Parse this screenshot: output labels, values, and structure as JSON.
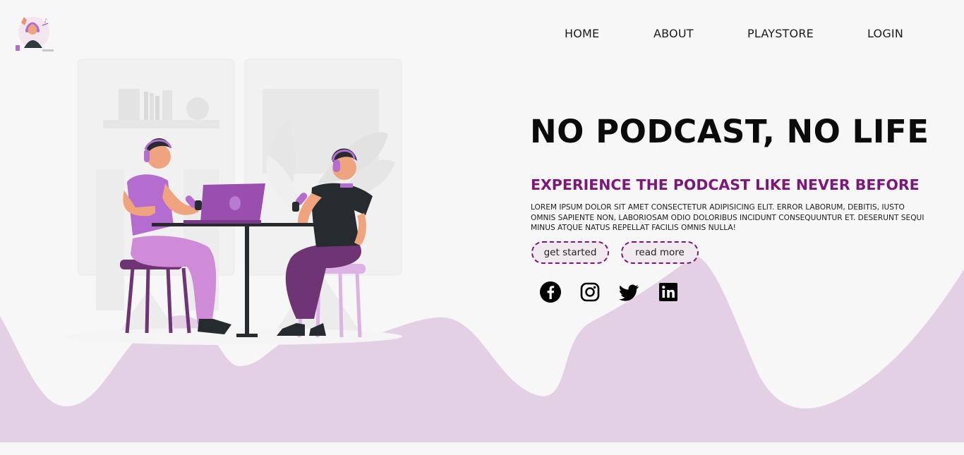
{
  "nav": {
    "items": [
      "HOME",
      "ABOUT",
      "PLAYSTORE",
      "LOGIN"
    ]
  },
  "hero": {
    "title": "NO PODCAST, NO LIFE",
    "subtitle": "EXPERIENCE THE PODCAST LIKE NEVER BEFORE",
    "body": "LOREM IPSUM DOLOR SIT AMET CONSECTETUR ADIPISICING ELIT. ERROR LABORUM, DEBITIS, IUSTO OMNIS SAPIENTE NON, LABORIOSAM ODIO DOLORIBUS INCIDUNT CONSEQUUNTUR ET. DESERUNT SEQUI MINUS ATQUE NATUS REPELLAT FACILIS OMNIS NULLA!",
    "buttons": {
      "get_started": "get started",
      "read_more": "read more"
    }
  },
  "social": [
    "facebook-icon",
    "instagram-icon",
    "twitter-icon",
    "linkedin-icon"
  ],
  "colors": {
    "accent": "#7d1679",
    "wave": "#e4d0e5",
    "background": "#f7f7f7",
    "shirt_purple": "#b46cd1",
    "pants_dark_purple": "#6f3473"
  }
}
